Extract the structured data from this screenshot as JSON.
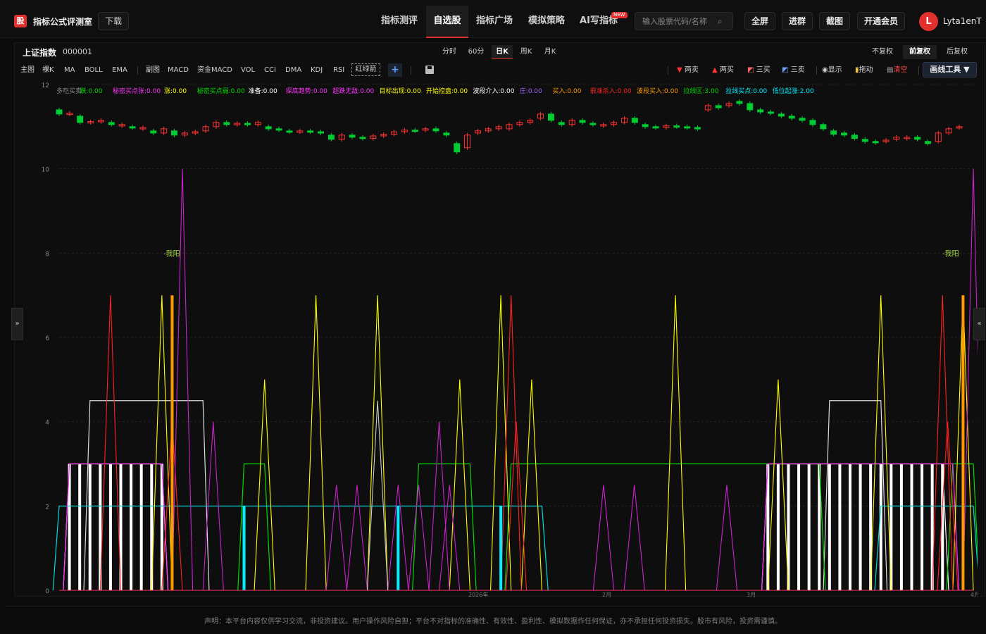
{
  "header": {
    "logo": "股",
    "brand": "指标公式评测室",
    "download": "下载",
    "nav": [
      "指标测评",
      "自选股",
      "指标广场",
      "模拟策略",
      "AI写指标"
    ],
    "new_badge": "NEW",
    "search_placeholder": "输入股票代码/名称",
    "buttons": [
      "全屏",
      "进群",
      "截图",
      "开通会员"
    ],
    "avatar_letter": "L",
    "username": "Lyta1enT"
  },
  "stock": {
    "name": "上证指数",
    "code": "000001"
  },
  "periods": [
    "分时",
    "60分",
    "日K",
    "周K",
    "月K"
  ],
  "adjust": [
    "不复权",
    "前复权",
    "后复权"
  ],
  "indicators_main": [
    "主图",
    "裸K",
    "MA",
    "BOLL",
    "EMA"
  ],
  "indicators_sub": [
    "副图",
    "MACD",
    "资金MACD",
    "VOL",
    "CCI",
    "DMA",
    "KDJ",
    "RSI"
  ],
  "red_green": "红绿箭",
  "tools": [
    "两卖",
    "两买",
    "三买",
    "三卖",
    "显示",
    "拖动",
    "清空"
  ],
  "draw_tool": "画线工具 ▼",
  "legend": [
    {
      "text": "多吃买卖",
      "color": "#888888"
    },
    {
      "text": "跌:0.00",
      "color": "#00dd00"
    },
    {
      "text": "秘密买点张:0.00",
      "color": "#ff33ff"
    },
    {
      "text": "涨:0.00",
      "color": "#ffff00"
    },
    {
      "text": "秘密买点弱:0.00",
      "color": "#00dd00"
    },
    {
      "text": "准备:0.00",
      "color": "#ffffff"
    },
    {
      "text": "探底趋势:0.00",
      "color": "#ff33ff"
    },
    {
      "text": "超跌无敌:0.00",
      "color": "#ff33ff"
    },
    {
      "text": "目标出现:0.00",
      "color": "#ffff00"
    },
    {
      "text": "开始控盘:0.00",
      "color": "#ffff00"
    },
    {
      "text": "波段介入:0.00",
      "color": "#ffffff"
    },
    {
      "text": "庄:0.00",
      "color": "#9966ff"
    },
    {
      "text": "买入:0.00",
      "color": "#ff9900"
    },
    {
      "text": "很准杀入:0.00",
      "color": "#ff2222"
    },
    {
      "text": "波段买入:0.00",
      "color": "#ff9900"
    },
    {
      "text": "拉线区:3.00",
      "color": "#00dd00"
    },
    {
      "text": "拉线买点:0.00",
      "color": "#00eeff"
    },
    {
      "text": "低位起涨:2.00",
      "color": "#00eeff"
    }
  ],
  "annotations": [
    {
      "text": "-我阳"
    },
    {
      "text": "-我阳"
    }
  ],
  "chart_data": {
    "type": "line",
    "ylim": [
      0,
      12
    ],
    "yticks": [
      0,
      2,
      4,
      6,
      8,
      10,
      12
    ],
    "x_labels": [
      "2026年",
      "2月",
      "3月",
      "4月"
    ],
    "n_points": 90,
    "series": [
      {
        "color": "#ffffff",
        "kind": "step",
        "values_desc": "white plateau 3",
        "segments": [
          [
            1,
            10,
            3
          ],
          [
            69,
            86,
            3
          ]
        ]
      },
      {
        "color": "#dddddd",
        "kind": "step",
        "segments": [
          [
            3,
            14,
            4.5
          ],
          [
            75,
            80,
            4.5
          ]
        ]
      },
      {
        "color": "#00dd00",
        "kind": "step",
        "segments": [
          [
            18,
            20,
            3
          ],
          [
            35,
            40,
            3
          ],
          [
            44,
            74,
            3
          ],
          [
            87,
            89,
            3
          ]
        ]
      },
      {
        "color": "#00dddd",
        "kind": "step",
        "segments": [
          [
            0,
            47,
            2
          ],
          [
            80,
            89,
            2
          ]
        ]
      },
      {
        "color": "#ff33ff",
        "kind": "step",
        "segments": [
          [
            1,
            10,
            3
          ],
          [
            69,
            87,
            3
          ]
        ]
      },
      {
        "color": "#ffff00",
        "kind": "peaks",
        "peaks": [
          [
            10,
            7
          ],
          [
            20,
            5
          ],
          [
            25,
            7
          ],
          [
            31,
            7
          ],
          [
            39,
            5
          ],
          [
            43,
            7
          ],
          [
            46,
            5
          ],
          [
            60,
            7
          ],
          [
            70,
            5
          ],
          [
            80,
            7
          ],
          [
            88,
            7
          ]
        ]
      },
      {
        "color": "#ff2222",
        "kind": "peaks",
        "peaks": [
          [
            5,
            7
          ],
          [
            11,
            4
          ],
          [
            44,
            7
          ],
          [
            44.5,
            4
          ],
          [
            86,
            7
          ],
          [
            86.5,
            4
          ]
        ]
      },
      {
        "color": "#cc22cc",
        "kind": "peaks",
        "peaks": [
          [
            12,
            10
          ],
          [
            15,
            4
          ],
          [
            27,
            2.5
          ],
          [
            29,
            2.5
          ],
          [
            33,
            2.5
          ],
          [
            35,
            2.5
          ],
          [
            37,
            4
          ],
          [
            38,
            2.5
          ],
          [
            53,
            2.5
          ],
          [
            56,
            2.5
          ],
          [
            65,
            2.5
          ],
          [
            89,
            10
          ]
        ]
      },
      {
        "color": "#cccccc",
        "kind": "peaks",
        "peaks": [
          [
            31,
            4.5
          ]
        ]
      },
      {
        "color": "#ff9900",
        "kind": "bars",
        "bars": [
          [
            11,
            7
          ],
          [
            88,
            7
          ]
        ]
      }
    ],
    "candles": [
      [
        11.4,
        11.3
      ],
      [
        11.3,
        11.32
      ],
      [
        11.25,
        11.1
      ],
      [
        11.1,
        11.12
      ],
      [
        11.12,
        11.15
      ],
      [
        11.1,
        11.05
      ],
      [
        11.02,
        11.05
      ],
      [
        11.0,
        10.98
      ],
      [
        10.95,
        10.98
      ],
      [
        10.9,
        10.85
      ],
      [
        10.85,
        10.95
      ],
      [
        10.9,
        10.8
      ],
      [
        10.8,
        10.85
      ],
      [
        10.85,
        10.88
      ],
      [
        10.9,
        11.0
      ],
      [
        11.0,
        11.1
      ],
      [
        11.1,
        11.05
      ],
      [
        11.05,
        11.08
      ],
      [
        11.08,
        11.05
      ],
      [
        11.05,
        11.1
      ],
      [
        11.0,
        10.95
      ],
      [
        10.95,
        10.92
      ],
      [
        10.9,
        10.88
      ],
      [
        10.88,
        10.9
      ],
      [
        10.9,
        10.88
      ],
      [
        10.88,
        10.85
      ],
      [
        10.8,
        10.7
      ],
      [
        10.7,
        10.8
      ],
      [
        10.8,
        10.75
      ],
      [
        10.75,
        10.72
      ],
      [
        10.72,
        10.78
      ],
      [
        10.78,
        10.82
      ],
      [
        10.82,
        10.88
      ],
      [
        10.88,
        10.92
      ],
      [
        10.92,
        10.9
      ],
      [
        10.92,
        10.95
      ],
      [
        10.95,
        10.9
      ],
      [
        10.85,
        10.8
      ],
      [
        10.6,
        10.4
      ],
      [
        10.5,
        10.8
      ],
      [
        10.85,
        10.9
      ],
      [
        10.9,
        10.95
      ],
      [
        10.95,
        11.0
      ],
      [
        10.95,
        11.05
      ],
      [
        11.05,
        11.1
      ],
      [
        11.1,
        11.15
      ],
      [
        11.2,
        11.3
      ],
      [
        11.3,
        11.15
      ],
      [
        11.1,
        11.05
      ],
      [
        11.05,
        11.15
      ],
      [
        11.15,
        11.1
      ],
      [
        11.08,
        11.05
      ],
      [
        11.02,
        11.05
      ],
      [
        11.05,
        11.1
      ],
      [
        11.1,
        11.2
      ],
      [
        11.2,
        11.1
      ],
      [
        11.05,
        11.0
      ],
      [
        11.0,
        10.98
      ],
      [
        10.98,
        11.02
      ],
      [
        11.02,
        11.0
      ],
      [
        11.0,
        10.98
      ],
      [
        10.98,
        10.95
      ],
      [
        11.4,
        11.5
      ],
      [
        11.5,
        11.45
      ],
      [
        11.5,
        11.55
      ],
      [
        11.6,
        11.55
      ],
      [
        11.55,
        11.4
      ],
      [
        11.4,
        11.35
      ],
      [
        11.35,
        11.32
      ],
      [
        11.3,
        11.25
      ],
      [
        11.25,
        11.2
      ],
      [
        11.2,
        11.15
      ],
      [
        11.15,
        11.05
      ],
      [
        11.05,
        10.95
      ],
      [
        10.9,
        10.82
      ],
      [
        10.85,
        10.8
      ],
      [
        10.8,
        10.72
      ],
      [
        10.7,
        10.65
      ],
      [
        10.65,
        10.62
      ],
      [
        10.65,
        10.68
      ],
      [
        10.7,
        10.75
      ],
      [
        10.72,
        10.75
      ],
      [
        10.75,
        10.7
      ],
      [
        10.65,
        10.6
      ],
      [
        10.65,
        10.85
      ],
      [
        10.85,
        10.95
      ],
      [
        10.98,
        11.0
      ]
    ]
  },
  "footer": "声明：本平台内容仅供学习交流，非投资建议。用户操作风险自担；平台不对指标的准确性、有效性、盈利性、模拟数据作任何保证，亦不承担任何投资损失。股市有风险，投资需谨慎。"
}
